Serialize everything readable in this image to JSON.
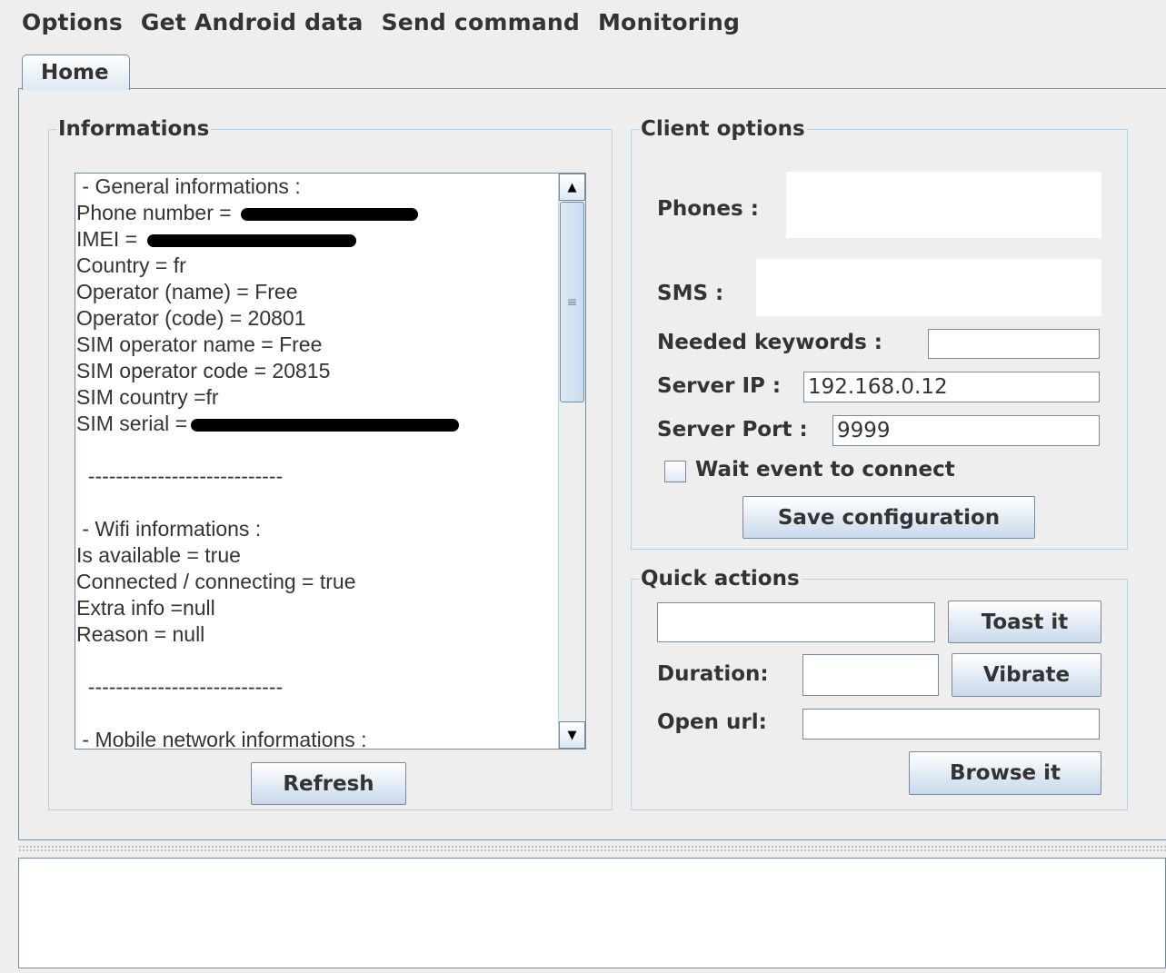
{
  "menubar": {
    "items": [
      "Options",
      "Get Android data",
      "Send command",
      "Monitoring"
    ]
  },
  "tabs": [
    {
      "label": "Home"
    }
  ],
  "informations": {
    "legend": "Informations",
    "lines": [
      " - General informations :",
      "Phone number = ",
      "IMEI = ",
      "Country = fr",
      "Operator (name) = Free",
      "Operator (code) = 20801",
      "SIM operator name = Free",
      "SIM operator code = 20815",
      "SIM country =fr",
      "SIM serial =",
      "",
      "  ----------------------------",
      "",
      " - Wifi informations :",
      "Is available = true",
      "Connected / connecting = true",
      "Extra info =null",
      "Reason = null",
      "",
      "  ----------------------------",
      "",
      " - Mobile network informations :"
    ],
    "refresh_label": "Refresh"
  },
  "client_options": {
    "legend": "Client options",
    "phones_label": "Phones :",
    "phones_value": "",
    "sms_label": "SMS :",
    "sms_value": "",
    "keywords_label": "Needed keywords :",
    "keywords_value": "",
    "server_ip_label": "Server IP :",
    "server_ip_value": "192.168.0.12",
    "server_port_label": "Server Port :",
    "server_port_value": "9999",
    "wait_label": "Wait event to connect",
    "wait_checked": false,
    "save_label": "Save configuration"
  },
  "quick_actions": {
    "legend": "Quick actions",
    "toast_value": "",
    "toast_label": "Toast it",
    "duration_label": "Duration:",
    "duration_value": "",
    "vibrate_label": "Vibrate",
    "open_url_label": "Open url:",
    "open_url_value": "",
    "browse_label": "Browse it"
  },
  "console": {
    "text": ""
  }
}
